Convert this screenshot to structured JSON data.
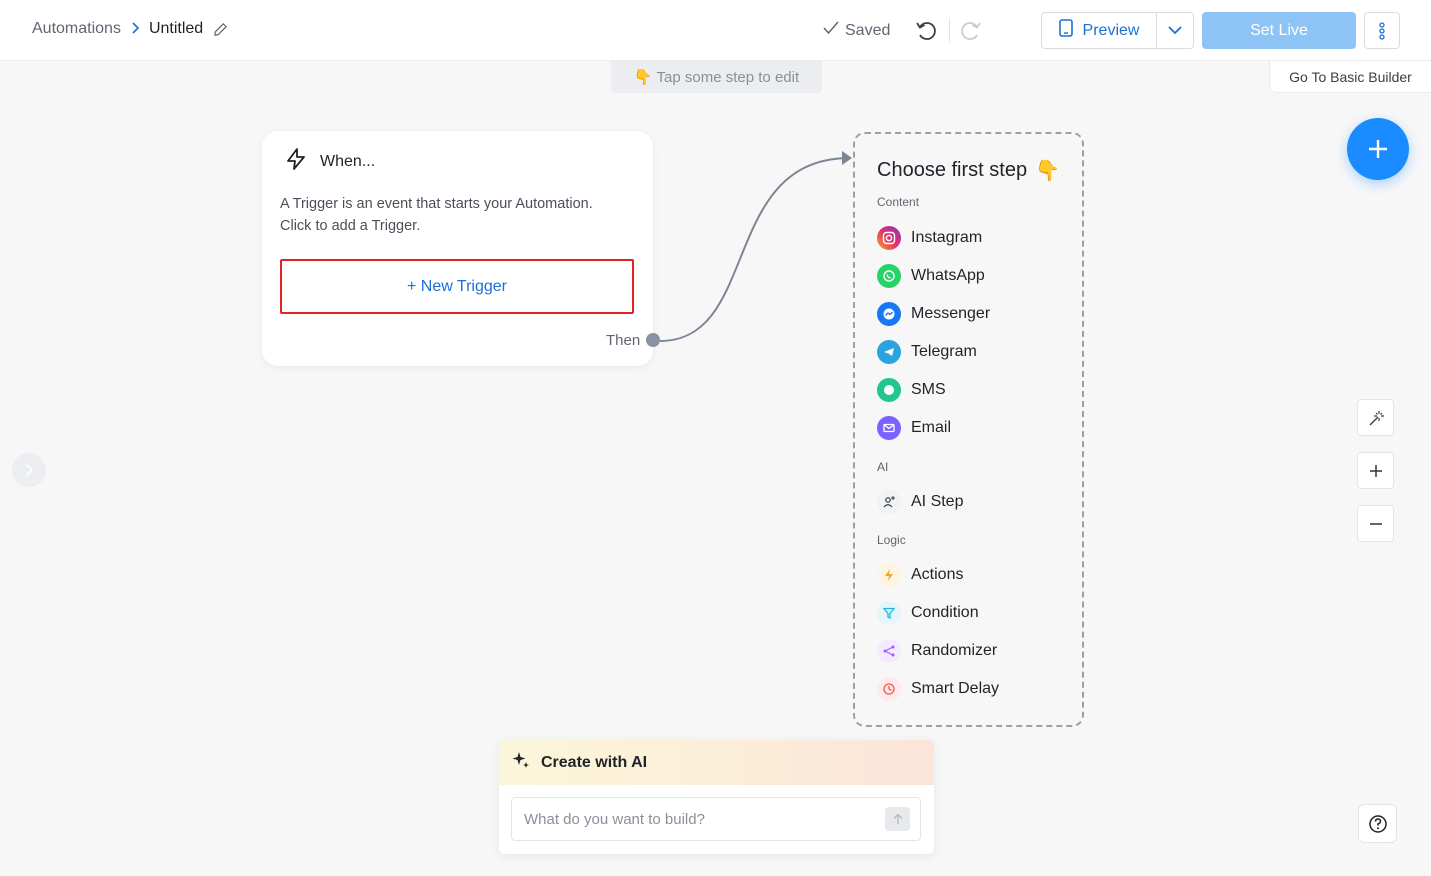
{
  "header": {
    "breadcrumb_root": "Automations",
    "breadcrumb_current": "Untitled",
    "saved_label": "Saved",
    "preview_label": "Preview",
    "set_live_label": "Set Live"
  },
  "hint_text": "Tap some step to edit",
  "basic_builder_label": "Go To Basic Builder",
  "trigger": {
    "title": "When...",
    "description": "A Trigger is an event that starts your Automation. Click to add a Trigger.",
    "new_trigger_label": "+ New Trigger",
    "then_label": "Then"
  },
  "steps": {
    "title": "Choose first step",
    "content_label": "Content",
    "content_items": [
      {
        "label": "Instagram",
        "icon": "instagram-icon",
        "color": "#e1306c"
      },
      {
        "label": "WhatsApp",
        "icon": "whatsapp-icon",
        "color": "#25d366"
      },
      {
        "label": "Messenger",
        "icon": "messenger-icon",
        "color": "#1877f2"
      },
      {
        "label": "Telegram",
        "icon": "telegram-icon",
        "color": "#2aa3df"
      },
      {
        "label": "SMS",
        "icon": "sms-icon",
        "color": "#22c58b"
      },
      {
        "label": "Email",
        "icon": "email-icon",
        "color": "#7b61ff"
      }
    ],
    "ai_label": "AI",
    "ai_items": [
      {
        "label": "AI Step",
        "icon": "ai-step-icon",
        "color": "#3a3f47"
      }
    ],
    "logic_label": "Logic",
    "logic_items": [
      {
        "label": "Actions",
        "icon": "actions-icon",
        "color": "#f5a524"
      },
      {
        "label": "Condition",
        "icon": "condition-icon",
        "color": "#1fb6e0"
      },
      {
        "label": "Randomizer",
        "icon": "randomizer-icon",
        "color": "#a259ff"
      },
      {
        "label": "Smart Delay",
        "icon": "smart-delay-icon",
        "color": "#f0584b"
      }
    ]
  },
  "ai_box": {
    "title": "Create with AI",
    "placeholder": "What do you want to build?"
  },
  "colors": {
    "accent": "#1a8cff",
    "set_live_bg": "#8ec4f5",
    "highlight_border": "#e02424"
  }
}
